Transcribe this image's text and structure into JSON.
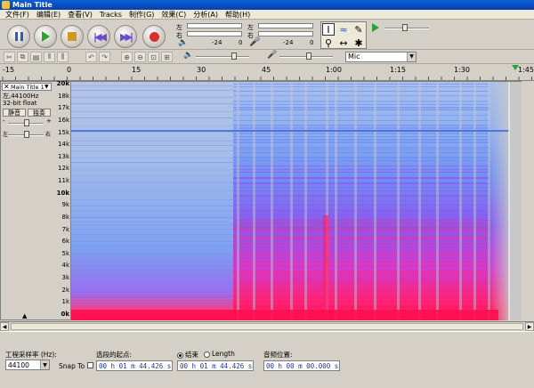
{
  "window": {
    "title": "Main Title"
  },
  "menu": [
    "文件(F)",
    "编辑(E)",
    "查看(V)",
    "Tracks",
    "制作(G)",
    "效果(C)",
    "分析(A)",
    "帮助(H)"
  ],
  "transport": [
    "pause",
    "play",
    "stop",
    "skip-start",
    "skip-end",
    "record"
  ],
  "meters": {
    "left": "左",
    "right": "右",
    "play_ticks": [
      "-24",
      "0"
    ],
    "rec_ticks": [
      "-24",
      "0"
    ]
  },
  "input_source": "Mic",
  "timeline_ticks": [
    "-15",
    "0",
    "15",
    "30",
    "45",
    "1:00",
    "1:15",
    "1:30",
    "1:45"
  ],
  "track": {
    "name": "Main Title 1",
    "info_line1": "左,44100Hz",
    "info_line2": "32-bit float",
    "mute_label": "静音",
    "solo_label": "独奏",
    "gain_minus": "-",
    "gain_plus": "+",
    "pan_left": "左",
    "pan_right": "右"
  },
  "freq_labels": [
    "20k",
    "18k",
    "17k",
    "16k",
    "15k",
    "14k",
    "13k",
    "12k",
    "11k",
    "10k",
    "9k",
    "8k",
    "7k",
    "6k",
    "5k",
    "4k",
    "3k",
    "2k",
    "1k",
    "0k"
  ],
  "status": {
    "rate_label": "工程采样率 (Hz):",
    "rate_value": "44100",
    "snap_label": "Snap To",
    "selection_start_label": "选段的起点:",
    "selection_start_value": "00 h 01 m 44.426 s",
    "end_label": "结束",
    "length_label": "Length",
    "selection_end_value": "00 h 01 m 44.426 s",
    "audio_pos_label": "音频位置:",
    "audio_pos_value": "00 h 00 m 00.000 s"
  },
  "colors": {
    "spectrum_high": "#ff2060",
    "spectrum_mid": "#c040ff",
    "spectrum_low": "#6090ff",
    "spectrum_bg": "#c8c8c8"
  }
}
